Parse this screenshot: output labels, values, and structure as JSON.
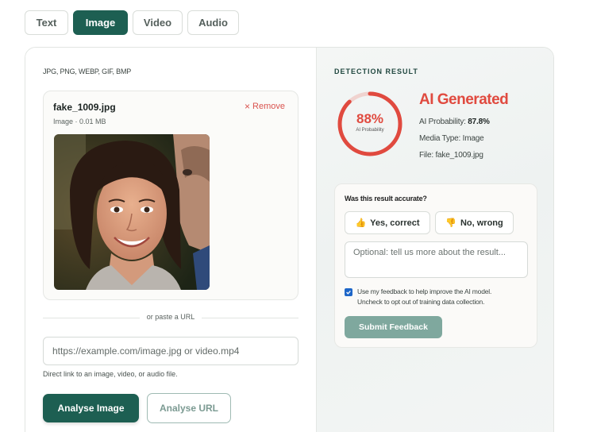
{
  "tabs": [
    "Text",
    "Image",
    "Video",
    "Audio"
  ],
  "active_tab": "Image",
  "upload": {
    "formats": "JPG, PNG, WEBP, GIF, BMP",
    "file_name": "fake_1009.jpg",
    "file_meta": "Image · 0.01 MB",
    "remove_label": "Remove",
    "preview_alt": "uploaded image preview"
  },
  "url_section": {
    "divider_text": "or paste a URL",
    "placeholder": "https://example.com/image.jpg or video.mp4",
    "help": "Direct link to an image, video, or audio file."
  },
  "actions": {
    "analyse_label": "Analyse Image",
    "analyse_url_label": "Analyse URL"
  },
  "result": {
    "section_title": "DETECTION RESULT",
    "probability_pct": "88%",
    "probability_value": 0.88,
    "probability_caption": "AI Probability",
    "verdict": "AI Generated",
    "prob_label": "AI Probability:",
    "prob_value": "87.8%",
    "media_type_line": "Media Type: Image",
    "file_line": "File: fake_1009.jpg",
    "accent_color": "#e04a3f"
  },
  "feedback": {
    "question": "Was this result accurate?",
    "yes_label": "Yes, correct",
    "no_label": "No, wrong",
    "placeholder": "Optional: tell us more about the result...",
    "consent_line1": "Use my feedback to help improve the AI model.",
    "consent_line2": "Uncheck to opt out of training data collection.",
    "submit_label": "Submit Feedback"
  }
}
